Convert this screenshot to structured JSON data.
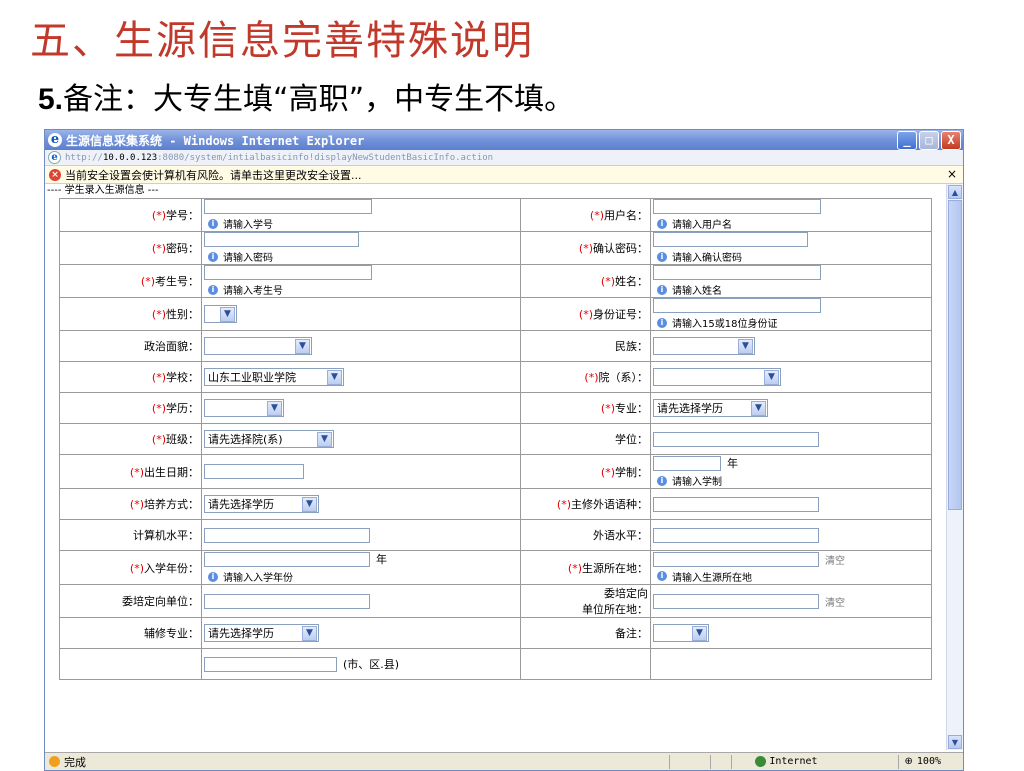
{
  "slide": {
    "title": "五、生源信息完善特殊说明",
    "subtitle_num": "5.",
    "subtitle_text": "备注：大专生填“高职”，中专生不填",
    "subtitle_end": "。"
  },
  "window": {
    "title": "生源信息采集系统 - Windows Internet Explorer",
    "controls": {
      "minimize": "_",
      "maximize": "□",
      "close": "X"
    },
    "address_prefix": "http://",
    "address_host": "10.0.0.123",
    "address_rest": ":8080/system/intialbasicinfo!displayNewStudentBasicInfo.action",
    "info_bar": "当前安全设置会使计算机有风险。请单击这里更改安全设置...",
    "info_close": "×",
    "section_label": "---- 学生录入生源信息 ---",
    "status_done": "完成",
    "status_zone": "Internet",
    "status_zoom": "100%"
  },
  "form": {
    "required_mark": "(*)",
    "rows": [
      [
        {
          "label": "学号：",
          "req": true,
          "type": "text",
          "hint": "请输入学号",
          "w": 168
        },
        {
          "label": "用户名：",
          "req": true,
          "type": "text",
          "hint": "请输入用户名",
          "w": 168
        }
      ],
      [
        {
          "label": "密码：",
          "req": true,
          "type": "text",
          "hint": "请输入密码",
          "w": 155
        },
        {
          "label": "确认密码：",
          "req": true,
          "type": "text",
          "hint": "请输入确认密码",
          "w": 155
        }
      ],
      [
        {
          "label": "考生号：",
          "req": true,
          "type": "text",
          "hint": "请输入考生号",
          "w": 168
        },
        {
          "label": "姓名：",
          "req": true,
          "type": "text",
          "hint": "请输入姓名",
          "w": 168
        }
      ],
      [
        {
          "label": "性别：",
          "req": true,
          "type": "select",
          "value": "",
          "w": 33
        },
        {
          "label": "身份证号：",
          "req": true,
          "type": "text",
          "hint": "请输入15或18位身份证",
          "w": 168
        }
      ],
      [
        {
          "label": "政治面貌：",
          "req": false,
          "type": "select",
          "value": "",
          "w": 108
        },
        {
          "label": "民族：",
          "req": false,
          "type": "select",
          "value": "",
          "w": 102
        }
      ],
      [
        {
          "label": "学校：",
          "req": true,
          "type": "select",
          "value": "山东工业职业学院",
          "w": 140
        },
        {
          "label": "院（系）：",
          "req": true,
          "type": "select",
          "value": "",
          "w": 128
        }
      ],
      [
        {
          "label": "学历：",
          "req": true,
          "type": "select",
          "value": "",
          "w": 80
        },
        {
          "label": "专业：",
          "req": true,
          "type": "select",
          "value": "请先选择学历",
          "w": 115
        }
      ],
      [
        {
          "label": "班级：",
          "req": true,
          "type": "select",
          "value": "请先选择院(系)",
          "w": 130
        },
        {
          "label": "学位：",
          "req": false,
          "type": "text",
          "w": 166
        }
      ],
      [
        {
          "label": "出生日期：",
          "req": true,
          "type": "text",
          "w": 100
        },
        {
          "label": "学制：",
          "req": true,
          "type": "text",
          "hint": "请输入学制",
          "w": 68,
          "suffix": "年"
        }
      ],
      [
        {
          "label": "培养方式：",
          "req": true,
          "type": "select",
          "value": "请先选择学历",
          "w": 115
        },
        {
          "label": "主修外语语种：",
          "req": true,
          "type": "text",
          "w": 166
        }
      ],
      [
        {
          "label": "计算机水平：",
          "req": false,
          "type": "text",
          "w": 166
        },
        {
          "label": "外语水平：",
          "req": false,
          "type": "text",
          "w": 166
        }
      ],
      [
        {
          "label": "入学年份：",
          "req": true,
          "type": "text",
          "hint": "请输入入学年份",
          "w": 166,
          "suffix": "年"
        },
        {
          "label": "生源所在地：",
          "req": true,
          "type": "text",
          "hint": "请输入生源所在地",
          "w": 166,
          "clear": "清空"
        }
      ],
      [
        {
          "label": "委培定向单位：",
          "req": false,
          "type": "text",
          "w": 166
        },
        {
          "label_lines": [
            "委培定向",
            "单位所在地："
          ],
          "req": false,
          "type": "text",
          "w": 166,
          "clear": "清空"
        }
      ],
      [
        {
          "label": "辅修专业：",
          "req": false,
          "type": "select",
          "value": "请先选择学历",
          "w": 115
        },
        {
          "label": "备注：",
          "req": false,
          "type": "select",
          "value": "",
          "w": 56
        }
      ],
      [
        {
          "label": "",
          "req": false,
          "type": "text",
          "w": 133,
          "suffix": "(市、区.县)"
        },
        {
          "label": "",
          "req": false,
          "type": "none"
        }
      ]
    ]
  },
  "colors": {
    "title_red": "#c0392b",
    "titlebar_blue": "#6f90d8",
    "highlight_ellipse": "#e02020"
  }
}
